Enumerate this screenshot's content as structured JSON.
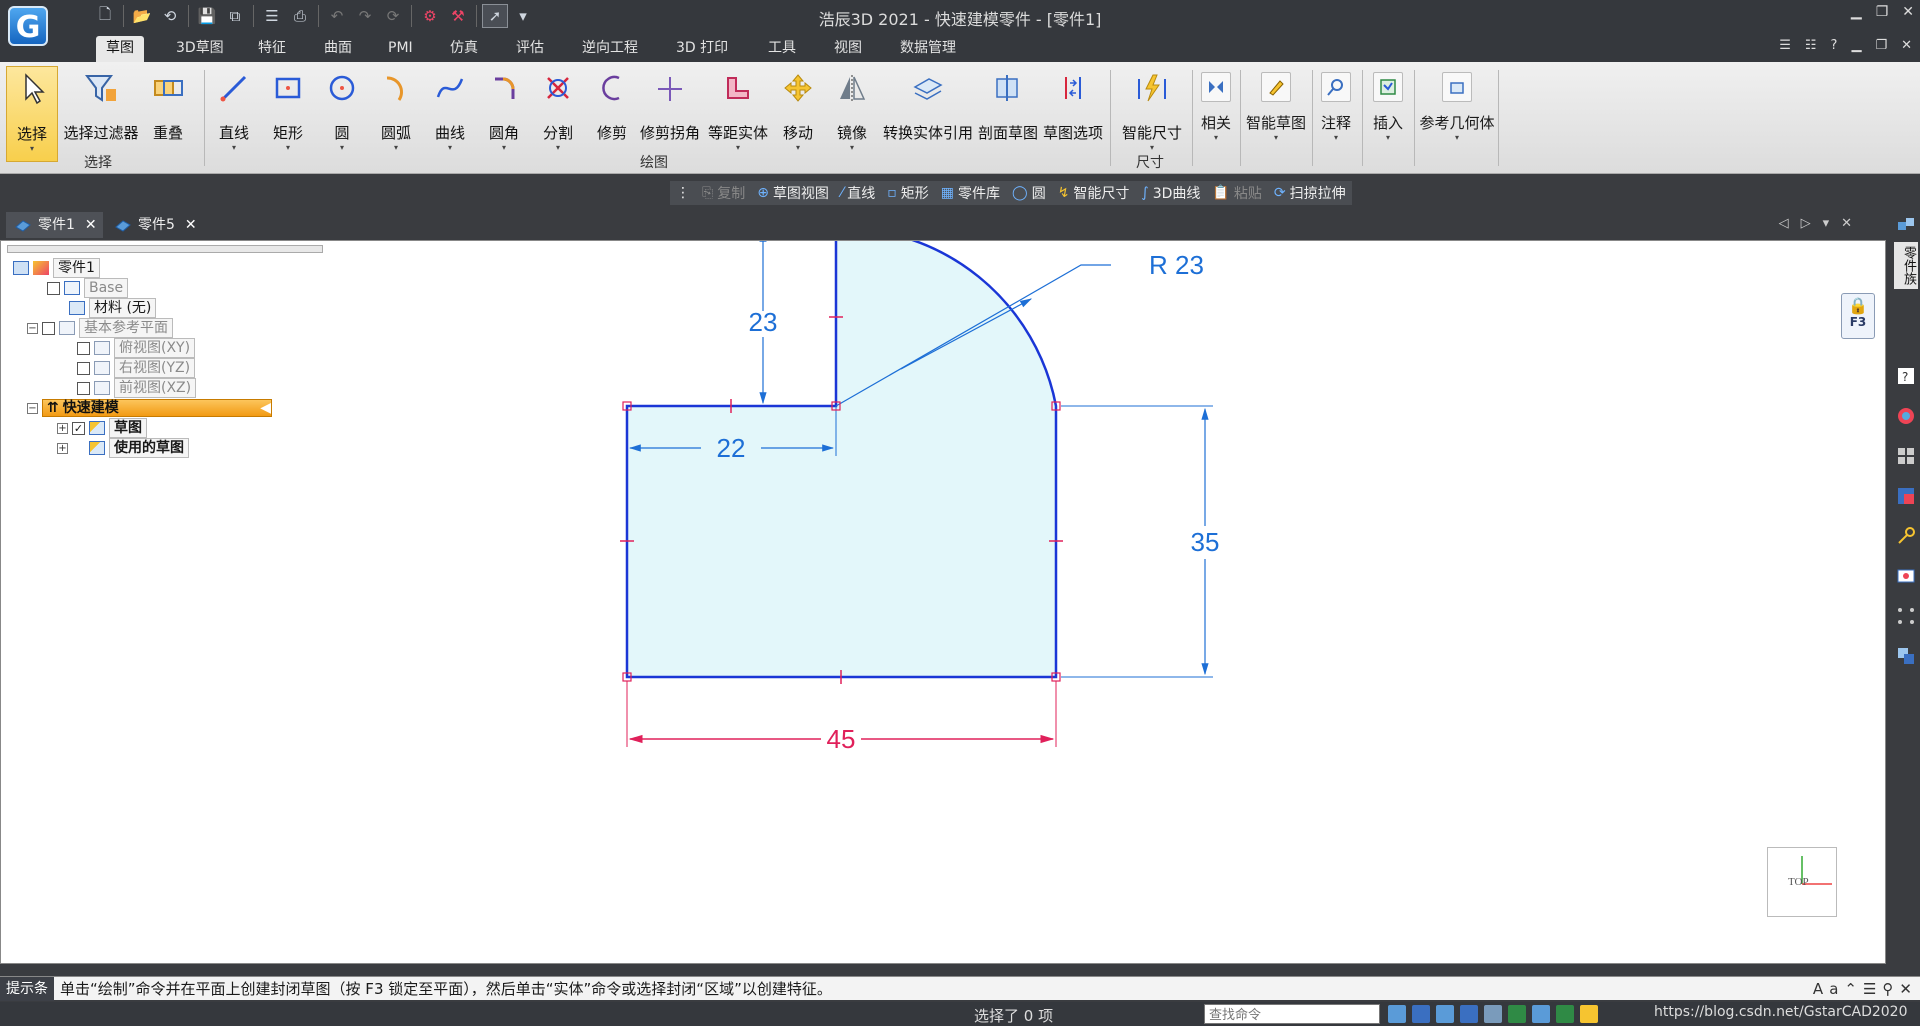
{
  "window": {
    "title": "浩辰3D 2021 - 快速建模零件 - [零件1]",
    "logo": "G"
  },
  "menu_tabs": [
    "草图",
    "3D草图",
    "特征",
    "曲面",
    "PMI",
    "仿真",
    "评估",
    "逆向工程",
    "3D 打印",
    "工具",
    "视图",
    "数据管理"
  ],
  "ribbon": {
    "select_group": {
      "label": "选择",
      "buttons": [
        "选择",
        "选择过滤器",
        "重叠"
      ]
    },
    "draw_group": {
      "label": "绘图",
      "buttons": [
        "直线",
        "矩形",
        "圆",
        "圆弧",
        "曲线",
        "圆角",
        "分割",
        "修剪",
        "修剪拐角",
        "等距实体",
        "移动",
        "镜像",
        "转换实体引用",
        "剖面草图",
        "草图选项"
      ]
    },
    "dim_group": {
      "label": "尺寸",
      "buttons": [
        "智能尺寸"
      ]
    },
    "small_buttons": [
      "相关",
      "智能草图",
      "注释",
      "插入",
      "参考几何体"
    ]
  },
  "context_toolbar": [
    {
      "label": "复制",
      "enabled": false
    },
    {
      "label": "草图视图",
      "enabled": true
    },
    {
      "label": "直线",
      "enabled": true
    },
    {
      "label": "矩形",
      "enabled": true
    },
    {
      "label": "零件库",
      "enabled": true
    },
    {
      "label": "圆",
      "enabled": true
    },
    {
      "label": "智能尺寸",
      "enabled": true
    },
    {
      "label": "3D曲线",
      "enabled": true
    },
    {
      "label": "粘贴",
      "enabled": false
    },
    {
      "label": "扫掠拉伸",
      "enabled": true
    }
  ],
  "doc_tabs": [
    {
      "label": "零件1",
      "close": "✕",
      "active": true
    },
    {
      "label": "零件5",
      "close": "✕",
      "active": false
    }
  ],
  "tree": {
    "root": "零件1",
    "base": "Base",
    "material": "材料 (无)",
    "ref_planes": "基本参考平面",
    "planes": [
      "俯视图(XY)",
      "右视图(YZ)",
      "前视图(XZ)"
    ],
    "feature": "快速建模",
    "sketch": "草图",
    "used_sketch": "使用的草图"
  },
  "sketch": {
    "dims": {
      "height_top": "23",
      "radius": "R 23",
      "width_step": "22",
      "height_right": "35",
      "width_bottom": "45"
    },
    "lock_key": "F3",
    "view_label": "TOP"
  },
  "sidebar": {
    "vertical_label": "零件族"
  },
  "status": {
    "tag": "提示条",
    "message": "单击“绘制”命令并在平面上创建封闭草图（按 F3 锁定至平面），然后单击“实体”命令或选择封闭“区域”以创建特征。",
    "selection": "选择了 0 项",
    "find_placeholder": "查找命令",
    "url": "https://blog.csdn.net/GstarCAD2020"
  },
  "colors": {
    "sketch_fill": "#e3f7fa",
    "sketch_line": "#1a36d6",
    "dim_blue": "#1d6fd6",
    "dim_red": "#e0205a",
    "accent": "#f8cf4c"
  }
}
